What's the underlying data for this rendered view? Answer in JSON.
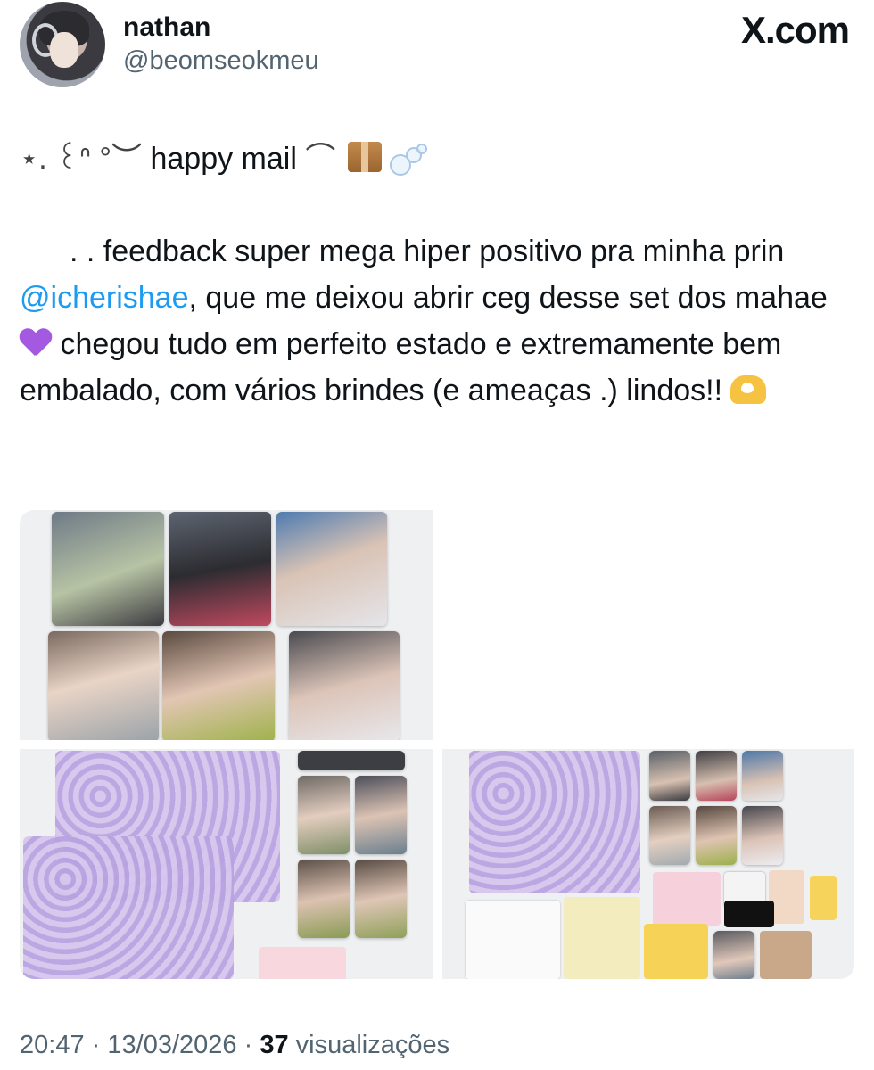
{
  "author": {
    "display_name": "nathan",
    "handle": "@beomseokmeu"
  },
  "brand": "X.com",
  "post": {
    "title_prefix": "⋆. ꒰ᐢ °︶",
    "title_text": "happy mail",
    "title_suffix": "⌒",
    "body_lead": ". . feedback super mega hiper positivo pra minha prin ",
    "mention": "@icherishae",
    "body_mid": ", que me deixou abrir ceg desse set dos mahae ",
    "body_tail": " chegou tudo em perfeito estado e extremamente bem embalado, com vários brindes (e ameaças .) lindos!! "
  },
  "footer": {
    "time": "20:47",
    "date": "13/03/2026",
    "views_count": "37",
    "views_label": "visualizações",
    "sep": "·"
  },
  "icons": [
    "package-emoji",
    "bubbles-emoji",
    "purple-heart-emoji",
    "heart-hands-emoji"
  ],
  "colors": {
    "link": "#1d9bf0",
    "text": "#0f1419",
    "muted": "#536471"
  }
}
